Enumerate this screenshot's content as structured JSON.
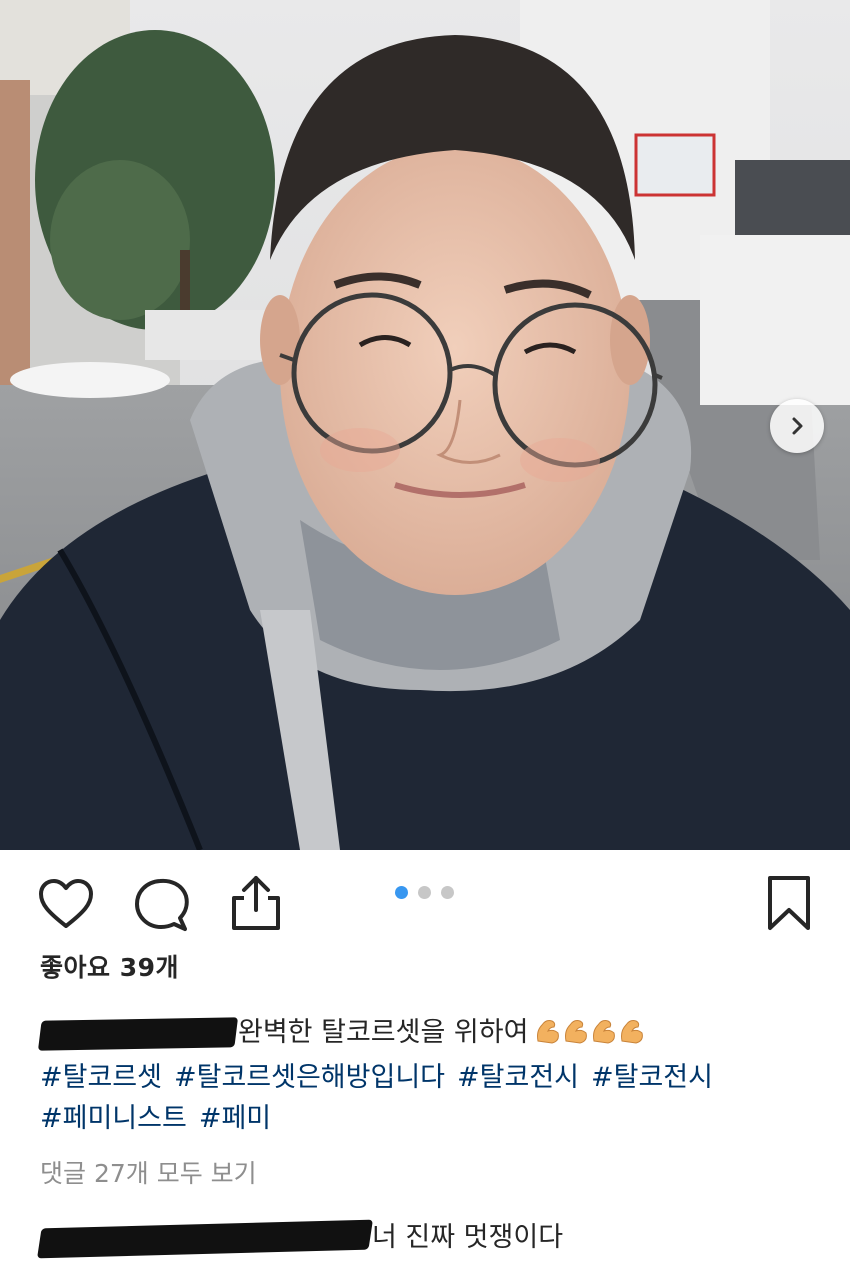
{
  "post": {
    "carousel": {
      "total": 3,
      "active_index": 0
    },
    "likes_label": "좋아요 39개",
    "caption": {
      "text": "완벽한 탈코르셋을 위하여",
      "emoji": [
        "flexed-biceps",
        "flexed-biceps",
        "flexed-biceps",
        "flexed-biceps"
      ],
      "hashtags": [
        "#탈코르셋",
        "#탈코르셋은해방입니다",
        "#탈코전시",
        "#탈코전시",
        "#페미니스트",
        "#페미"
      ]
    },
    "view_comments_label": "댓글 27개 모두 보기",
    "comment": {
      "text": "너 진짜 멋쟁이다"
    }
  },
  "icons": {
    "like": "heart-icon",
    "comment": "comment-bubble-icon",
    "share": "share-icon",
    "save": "bookmark-icon",
    "next": "chevron-right-icon"
  },
  "colors": {
    "hashtag": "#003569",
    "active_dot": "#3897f0",
    "muted": "#8e8e8e"
  }
}
